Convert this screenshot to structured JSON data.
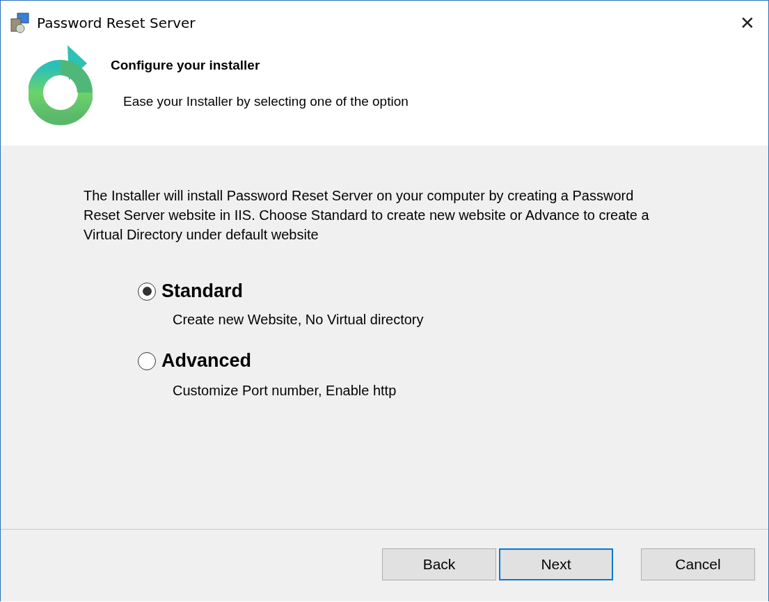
{
  "window": {
    "title": "Password Reset Server",
    "close": "✕"
  },
  "header": {
    "title": "Configure your installer",
    "subtitle": "Ease your Installer by selecting one of the option"
  },
  "description": "The Installer will install Password Reset Server on your computer by creating a Password Reset Server website in IIS. Choose Standard to create new website or Advance to create a Virtual Directory under default website",
  "options": [
    {
      "label": "Standard",
      "detail": "Create new Website, No Virtual directory",
      "selected": true
    },
    {
      "label": "Advanced",
      "detail": "Customize Port number, Enable http",
      "selected": false
    }
  ],
  "buttons": [
    {
      "label": "Back",
      "focused": false
    },
    {
      "label": "Next",
      "focused": true
    },
    {
      "label": "Cancel",
      "focused": false
    }
  ]
}
